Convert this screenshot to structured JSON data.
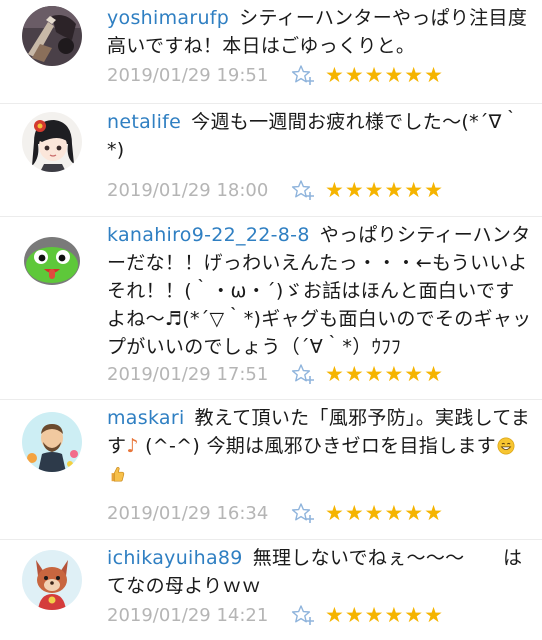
{
  "comments": [
    {
      "author": "yoshimarufp",
      "text": "シティーハンターやっぱり注目度高いですね！本日はごゆっくりと。",
      "timestamp": "2019/01/29 19:51",
      "stars": "★★★★★★",
      "star_add_icon": "star-add-icon"
    },
    {
      "author": "netalife",
      "text": "今週も一週間お疲れ様でした〜(*´∇｀*)",
      "timestamp": "2019/01/29 18:00",
      "stars": "★★★★★★",
      "star_add_icon": "star-add-icon"
    },
    {
      "author": "kanahiro9-22_22-8-8",
      "text": "やっぱりシティーハンターだな！！げっわいえんたっ・・・←もういいよそれ！！(｀・ω・´)ゞお話はほんと面白いですよね〜♬(*´▽｀*)ギャグも面白いのでそのギャップがいいのでしょう（´∀｀*）ｳﾌﾌ",
      "timestamp": "2019/01/29 17:51",
      "stars": "★★★★★★",
      "star_add_icon": "star-add-icon"
    },
    {
      "author": "maskari",
      "text_before_note": "教えて頂いた「風邪予防」。実践してます",
      "note": "♪",
      "text_after_note": " (^-^) 今期は風邪ひきゼロを目指します",
      "emojis": [
        "grinning-face-emoji",
        "thumbs-up-emoji"
      ],
      "timestamp": "2019/01/29 16:34",
      "stars": "★★★★★★",
      "star_add_icon": "star-add-icon"
    },
    {
      "author": "ichikayuiha89",
      "text": "無理しないでねぇ〜〜〜　　はてなの母よりｗｗ",
      "timestamp": "2019/01/29 14:21",
      "stars": "★★★★★★",
      "star_add_icon": "star-add-icon"
    }
  ],
  "colors": {
    "author": "#2f7fc2",
    "timestamp": "#b5b5b5",
    "star": "#f5b400",
    "star_add": "#8fb4dc",
    "note": "#e8763a"
  }
}
